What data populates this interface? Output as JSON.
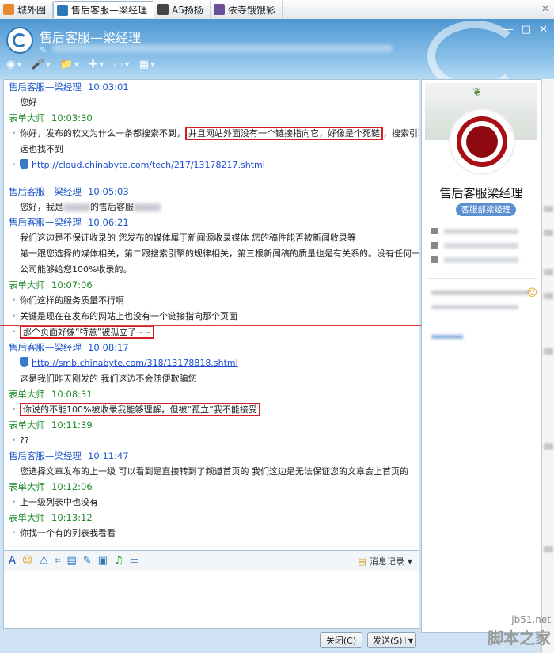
{
  "tabs": [
    {
      "label": "城外圈",
      "color": "#e8892f"
    },
    {
      "label": "售后客服—梁经理",
      "color": "#2c77b8",
      "active": true
    },
    {
      "label": "A5扬扬",
      "color": "#444444"
    },
    {
      "label": "依寺饿饿彩",
      "color": "#6b4f9a"
    }
  ],
  "window": {
    "title": "售后客服—梁经理",
    "controls": [
      "—",
      "□",
      "✕"
    ]
  },
  "toolbar": [
    {
      "icon": "video-icon",
      "glyph": "◉"
    },
    {
      "icon": "voice-icon",
      "glyph": "🎤"
    },
    {
      "icon": "file-icon",
      "glyph": "📁"
    },
    {
      "icon": "app-icon",
      "glyph": "✚"
    },
    {
      "icon": "screen-icon",
      "glyph": "▭"
    },
    {
      "icon": "more-apps-icon",
      "glyph": "▦"
    }
  ],
  "messages": [
    {
      "sender": "售后客服—梁经理",
      "time": "10:03:01",
      "role": "agent",
      "lines": [
        {
          "text": "您好"
        }
      ]
    },
    {
      "sender": "表单大师",
      "time": "10:03:30",
      "role": "me",
      "lines": [
        {
          "pre": "你好，发布的软文为什么一条都搜索不到，",
          "boxed": "并且网站外面没有一个链接指向它，好像是个死链",
          "post": "，搜索引擎永"
        },
        {
          "text": "远也找不到",
          "nodot": true
        },
        {
          "link": "http://cloud.chinabyte.com/tech/217/13178217.shtml"
        }
      ]
    },
    {
      "sender": "售后客服—梁经理",
      "time": "10:05:03",
      "role": "agent",
      "lines": [
        {
          "pre": "您好，我是",
          "blur": true,
          "post": "的售后客服",
          "blur2": true
        }
      ]
    },
    {
      "sender": "售后客服—梁经理",
      "time": "10:06:21",
      "role": "agent",
      "lines": [
        {
          "text": "我们这边是不保证收录的    您发布的媒体属于新闻源收录媒体    您的稿件能否被新闻收录等"
        },
        {
          "text": "第一跟您选择的媒体相关，第二跟搜索引擎的规律相关，第三根新闻稿的质量也是有关系的。没有任何一家"
        },
        {
          "text": "公司能够给您100%收录的。"
        }
      ]
    },
    {
      "sender": "表单大师",
      "time": "10:07:06",
      "role": "me",
      "lines": [
        {
          "text": "你们这样的服务质量不行啊"
        },
        {
          "text": "关键是现在在发布的网站上也没有一个链接指向那个页面"
        },
        {
          "boxed": "那个页面好像“特意”被孤立了~~"
        }
      ]
    },
    {
      "sender": "售后客服—梁经理",
      "time": "10:08:17",
      "role": "agent",
      "lines": [
        {
          "link": "http://smb.chinabyte.com/318/13178818.shtml"
        },
        {
          "text": "这是我们昨天刚发的    我们这边不会随便欺骗您"
        }
      ]
    },
    {
      "sender": "表单大师",
      "time": "10:08:31",
      "role": "me",
      "lines": [
        {
          "boxed": "你说的不能100%被收录我能够理解，但被“孤立”我不能接受"
        }
      ]
    },
    {
      "sender": "表单大师",
      "time": "10:11:39",
      "role": "me",
      "lines": [
        {
          "text": "??"
        }
      ]
    },
    {
      "sender": "售后客服—梁经理",
      "time": "10:11:47",
      "role": "agent",
      "lines": [
        {
          "text": "您选择文章发布的上一级    可以看到是直接转到了频道首页的    我们这边是无法保证您的文章会上首页的"
        }
      ]
    },
    {
      "sender": "表单大师",
      "time": "10:12:06",
      "role": "me",
      "lines": [
        {
          "text": "上一级列表中也没有"
        }
      ]
    },
    {
      "sender": "表单大师",
      "time": "10:13:12",
      "role": "me",
      "lines": [
        {
          "text": "你找一个有的列表我看看"
        }
      ]
    }
  ],
  "input_toolbar": {
    "icons": [
      {
        "name": "font-icon",
        "glyph": "A",
        "color": "#1b4fb8"
      },
      {
        "name": "emoji-icon",
        "glyph": "☺",
        "color": "#e2a21b"
      },
      {
        "name": "shake-icon",
        "glyph": "⚠",
        "color": "#2c77b8"
      },
      {
        "name": "screenshot-icon",
        "glyph": "⌗",
        "color": "#2c77b8"
      },
      {
        "name": "note-icon",
        "glyph": "▤",
        "color": "#2c77b8"
      },
      {
        "name": "edit-icon",
        "glyph": "✎",
        "color": "#2c77b8"
      },
      {
        "name": "image-icon",
        "glyph": "▣",
        "color": "#2c77b8"
      },
      {
        "name": "music-icon",
        "glyph": "♫",
        "color": "#2c9a2c"
      },
      {
        "name": "screen-share-icon",
        "glyph": "▭",
        "color": "#2c77b8"
      }
    ],
    "history_label": "消息记录"
  },
  "buttons": {
    "close_label": "关闭(C)",
    "send_label": "发送(S)"
  },
  "side": {
    "name": "售后客服梁经理",
    "badge": "客服部梁经理"
  },
  "watermark": {
    "line1": "jb51.net",
    "line2": "脚本之家"
  }
}
